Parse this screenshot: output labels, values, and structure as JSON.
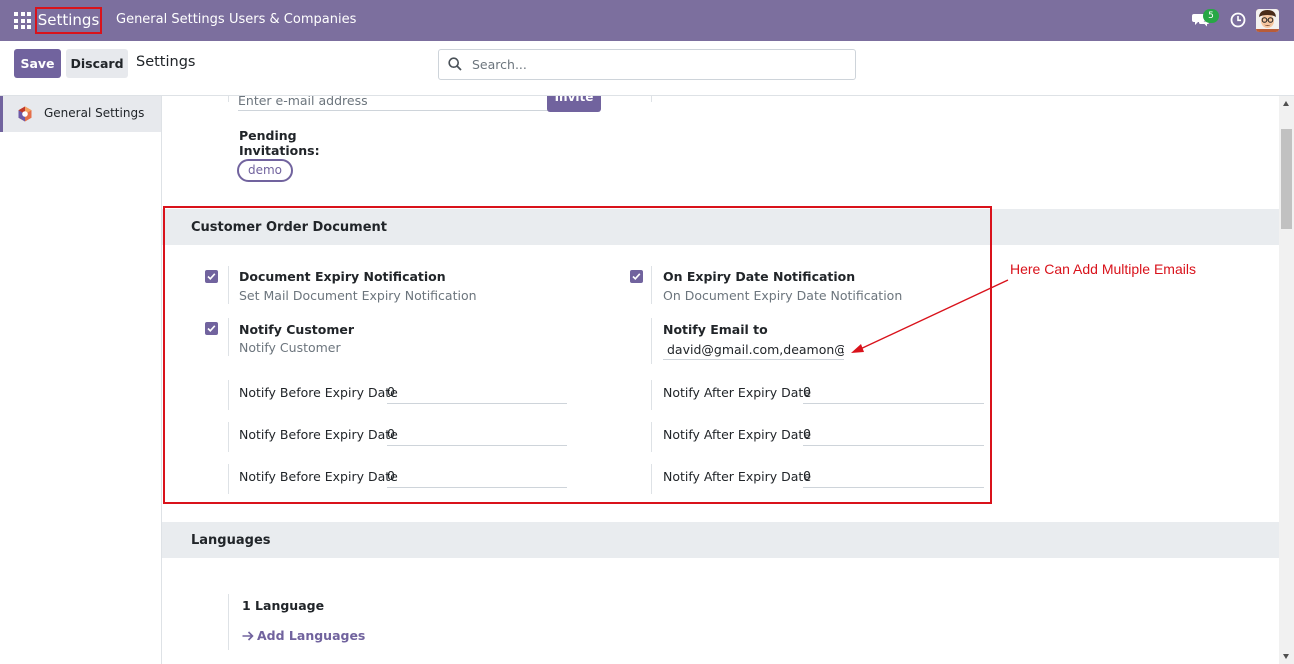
{
  "navbar": {
    "app_title": "Settings",
    "menu": [
      "General Settings",
      "Users & Companies"
    ],
    "chat_count": "5"
  },
  "control": {
    "save_label": "Save",
    "discard_label": "Discard",
    "title": "Settings",
    "search_placeholder": "Search..."
  },
  "sidebar": {
    "items": [
      {
        "label": "General Settings"
      }
    ]
  },
  "users": {
    "email_placeholder": "Enter e-mail address",
    "invite_label": "Invite",
    "pending_label": "Pending Invitations:",
    "pending": [
      "demo"
    ]
  },
  "customer_order": {
    "title": "Customer Order Document",
    "doc_expiry": {
      "title": "Document Expiry Notification",
      "desc": "Set Mail Document Expiry Notification",
      "checked": true
    },
    "on_expiry": {
      "title": "On Expiry Date Notification",
      "desc": "On Document Expiry Date Notification",
      "checked": true
    },
    "notify_customer": {
      "title": "Notify Customer",
      "desc": "Notify Customer",
      "checked": true
    },
    "notify_email": {
      "title": "Notify Email to",
      "value": "david@gmail.com,deamon@gr"
    },
    "before_rows": [
      {
        "label": "Notify Before Expiry Date",
        "value": "0"
      },
      {
        "label": "Notify Before Expiry Date",
        "value": "0"
      },
      {
        "label": "Notify Before Expiry Date",
        "value": "0"
      }
    ],
    "after_rows": [
      {
        "label": "Notify After Expiry Date",
        "value": "0"
      },
      {
        "label": "Notify After Expiry Date",
        "value": "0"
      },
      {
        "label": "Notify After Expiry Date",
        "value": "0"
      }
    ]
  },
  "annotation": "Here Can Add Multiple Emails",
  "languages": {
    "title": "Languages",
    "count_label": "1 Language",
    "add_label": "Add Languages"
  },
  "colors": {
    "brand": "#7c6f9e",
    "primary": "#71639e",
    "highlight": "#d9121b"
  }
}
